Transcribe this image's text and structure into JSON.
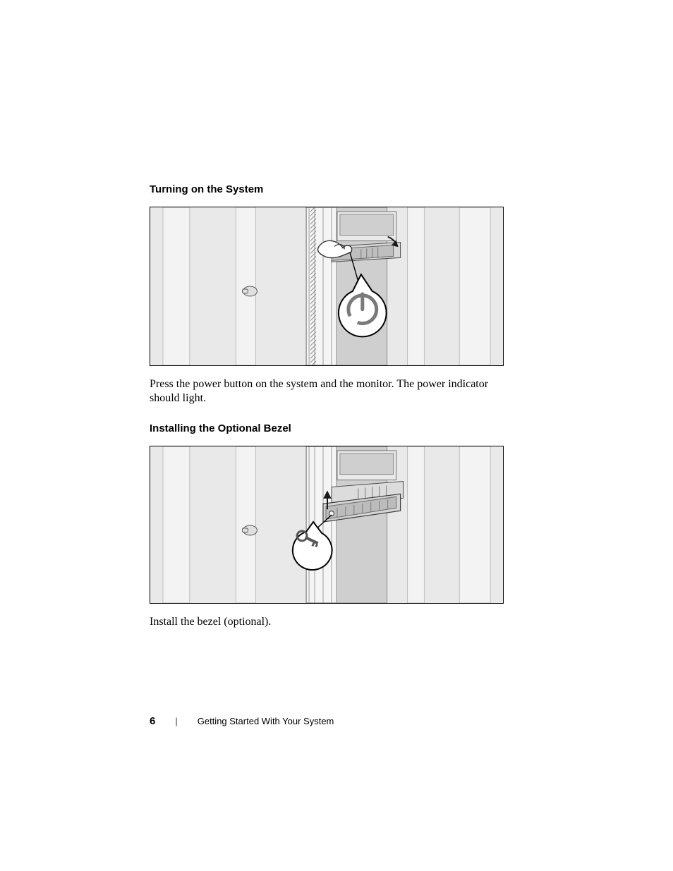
{
  "headings": {
    "h1": "Turning on the System",
    "h2": "Installing the Optional Bezel"
  },
  "paragraphs": {
    "p1": "Press the power button on the system and the monitor. The power indicator should light.",
    "p2": "Install the bezel (optional)."
  },
  "footer": {
    "page_number": "6",
    "separator": "|",
    "section_title": "Getting Started With Your System"
  },
  "figures": {
    "fig1_alt": "Server rack illustration with callout showing power button location",
    "fig2_alt": "Server rack illustration with callout showing optional front bezel and key lock"
  }
}
